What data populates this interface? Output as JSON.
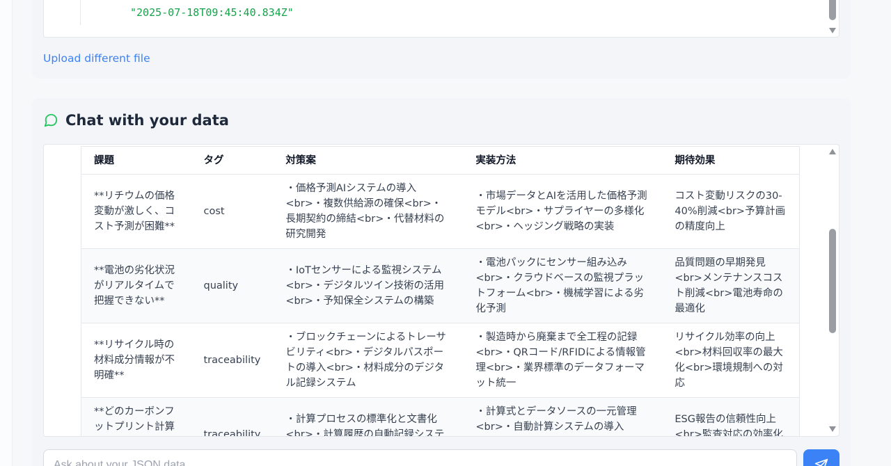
{
  "viewer": {
    "code_line": "\"2025-07-18T09:45:40.834Z\"",
    "upload_link": "Upload different file"
  },
  "chat": {
    "title": "Chat with your data",
    "input_placeholder": "Ask about your JSON data...",
    "table": {
      "headers": [
        "課題",
        "タグ",
        "対策案",
        "実装方法",
        "期待効果"
      ],
      "rows": [
        {
          "issue": "**リチウムの価格変動が激しく、コスト予測が困難**",
          "tag": "cost",
          "measure": "・価格予測AIシステムの導入<br>・複数供給源の確保<br>・長期契約の締結<br>・代替材料の研究開発",
          "method": "・市場データとAIを活用した価格予測モデル<br>・サプライヤーの多様化<br>・ヘッジング戦略の実装",
          "effect": "コスト変動リスクの30-40%削減<br>予算計画の精度向上"
        },
        {
          "issue": "**電池の劣化状況がリアルタイムで把握できない**",
          "tag": "quality",
          "measure": "・IoTセンサーによる監視システム<br>・デジタルツイン技術の活用<br>・予知保全システムの構築",
          "method": "・電池パックにセンサー組み込み<br>・クラウドベースの監視プラットフォーム<br>・機械学習による劣化予測",
          "effect": "品質問題の早期発見<br>メンテナンスコスト削減<br>電池寿命の最適化"
        },
        {
          "issue": "**リサイクル時の材料成分情報が不明確**",
          "tag": "traceability",
          "measure": "・ブロックチェーンによるトレーサビリティ<br>・デジタルパスポートの導入<br>・材料成分のデジタル記録システム",
          "method": "・製造時から廃棄まで全工程の記録<br>・QRコード/RFIDによる情報管理<br>・業界標準のデータフォーマット統一",
          "effect": "リサイクル効率の向上<br>材料回収率の最大化<br>環境規制への対応"
        },
        {
          "issue": "**どのカーボンフットプリント計算式を使ったか覚えていない**",
          "tag": "traceability",
          "measure": "・計算プロセスの標準化と文書化<br>・計算履歴の自動記録システム<br>・監査証跡の確立",
          "method": "・計算式とデータソースの一元管理<br>・自動計算システムの導入<br>・バージョン管理とトレーサビリティ",
          "effect": "ESG報告の信頼性向上<br>監査対応の効率化<br>規制遵守の確実性"
        }
      ]
    }
  },
  "colors": {
    "accent": "#3b82f6",
    "chat_icon": "#22c55e",
    "json_string": "#16a34a"
  },
  "icons": {
    "chat": "message-circle-icon",
    "send": "send-icon"
  }
}
